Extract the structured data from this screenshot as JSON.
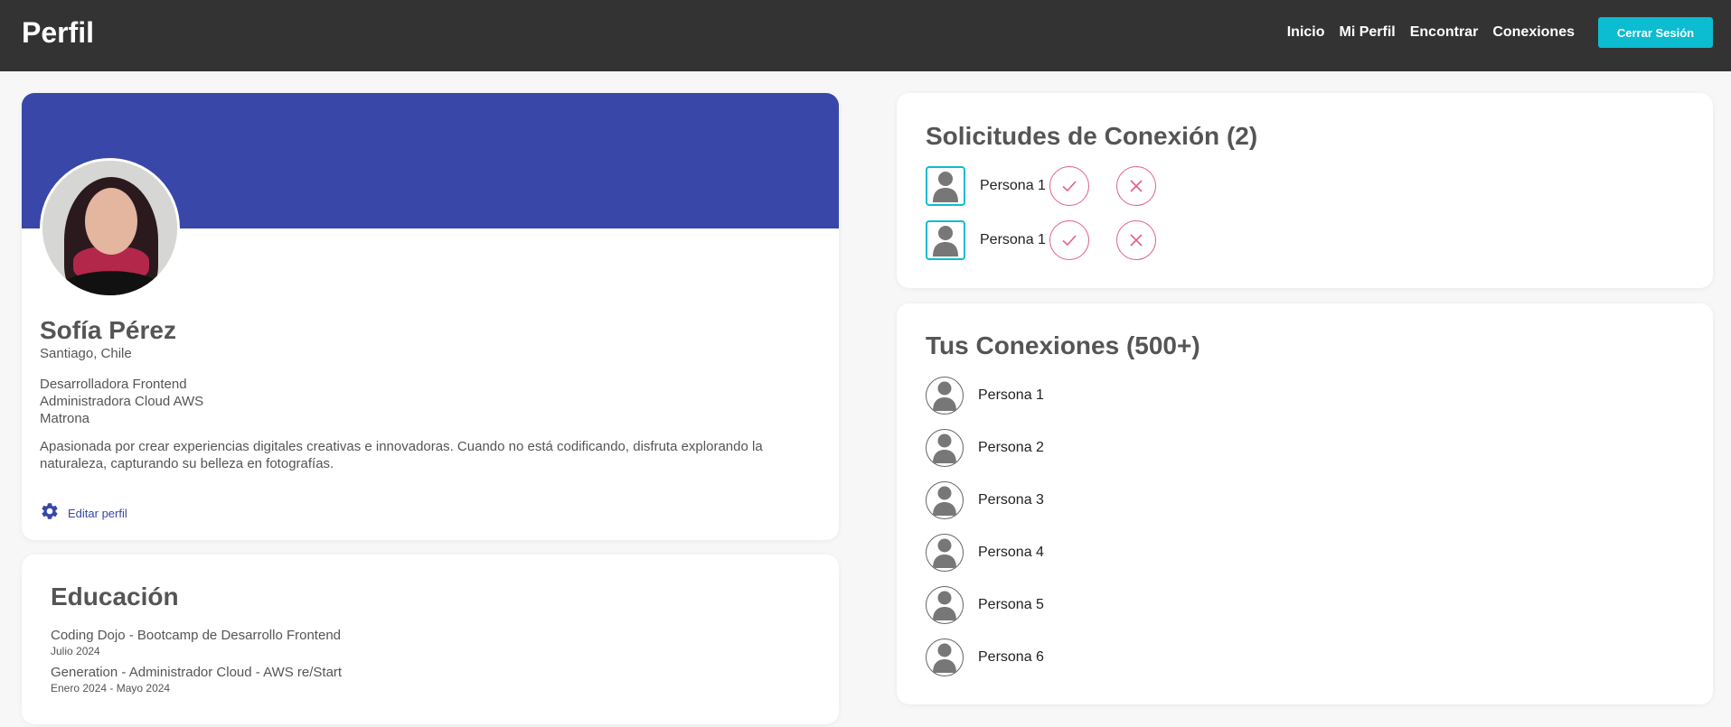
{
  "header": {
    "title": "Perfil",
    "nav": [
      "Inicio",
      "Mi Perfil",
      "Encontrar",
      "Conexiones"
    ],
    "logout_label": "Cerrar Sesión"
  },
  "profile": {
    "name": "Sofía Pérez",
    "location": "Santiago, Chile",
    "roles": [
      "Desarrolladora Frontend",
      "Administradora Cloud AWS",
      "Matrona"
    ],
    "bio": "Apasionada por crear experiencias digitales creativas e innovadoras. Cuando no está codificando, disfruta explorando la naturaleza, capturando su belleza en fotografías.",
    "edit_label": "Editar perfil",
    "banner_color": "#3847a8"
  },
  "education": {
    "title": "Educación",
    "items": [
      {
        "name": "Coding Dojo - Bootcamp de Desarrollo Frontend",
        "date": "Julio 2024"
      },
      {
        "name": "Generation - Administrador Cloud - AWS re/Start",
        "date": "Enero 2024 - Mayo 2024"
      }
    ]
  },
  "requests": {
    "title": "Solicitudes de Conexión (2)",
    "items": [
      {
        "name": "Persona 1"
      },
      {
        "name": "Persona 1"
      }
    ]
  },
  "connections": {
    "title": "Tus Conexiones (500+)",
    "items": [
      {
        "name": "Persona 1"
      },
      {
        "name": "Persona 2"
      },
      {
        "name": "Persona 3"
      },
      {
        "name": "Persona 4"
      },
      {
        "name": "Persona 5"
      },
      {
        "name": "Persona 6"
      }
    ]
  },
  "colors": {
    "topbar": "#333333",
    "accent": "#0cbcd1",
    "brand_blue": "#3847a8",
    "action_pink": "#e0608c",
    "icons": {
      "user": "user-silhouette-icon",
      "accept": "check-icon",
      "reject": "close-icon",
      "edit": "gear-icon"
    }
  }
}
